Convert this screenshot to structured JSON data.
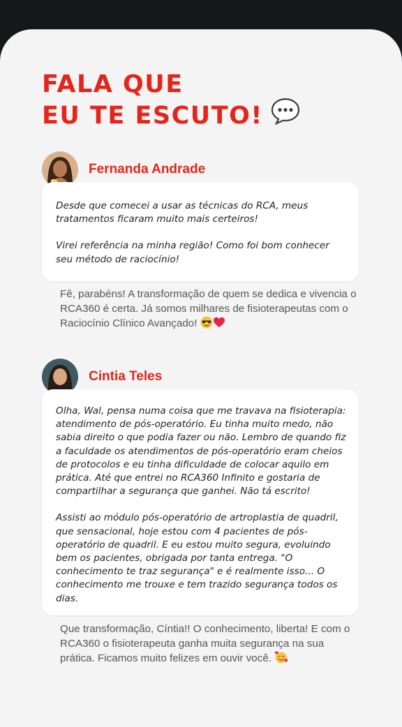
{
  "headline": {
    "line1": "FALA QUE",
    "line2": "EU TE ESCUTO!"
  },
  "icons": {
    "headline": "speech-bubble-icon",
    "reply1": [
      "sunglasses-emoji-icon",
      "heart-icon"
    ],
    "reply2": [
      "hearts-face-emoji-icon"
    ]
  },
  "colors": {
    "accent": "#e3261b",
    "background": "#16171a",
    "card": "#f4f4f4",
    "bubble": "#ffffff"
  },
  "testimonials": [
    {
      "name": "Fernanda Andrade",
      "message": [
        "Desde que comecei a usar as técnicas do RCA, meus tratamentos ficaram muito mais certeiros!",
        "Virei referência na minha região! Como foi bom conhecer seu método de raciocínio!"
      ],
      "reply": "Fê, parabéns! A transformação de quem se dedica e vivencia o RCA360 é certa. Já somos milhares de fisioterapeutas com o Raciocínio Clínico Avançado!"
    },
    {
      "name": "Cintia Teles",
      "message": [
        "Olha, Wal, pensa numa coisa que me travava na fisioterapia: atendimento de pós-operatório. Eu tinha muito medo, não sabia direito o que podia fazer ou não. Lembro de quando fiz a faculdade os atendimentos de pós-operatório eram cheios de protocolos e eu tinha dificuldade de colocar aquilo em prática. Até que entrei no RCA360 Infinito e gostaria de compartilhar a segurança que ganhei. Não tá escrito!",
        "Assisti ao módulo pós-operatório de artroplastia de quadril, que sensacional, hoje estou com 4 pacientes de pós-operatório de quadril. E eu estou muito segura, evoluindo bem os pacientes, obrigada por tanta entrega. \"O conhecimento te traz segurança\" e é realmente isso... O conhecimento me trouxe e tem trazido segurança todos os dias."
      ],
      "reply": "Que transformação, Cíntia!! O conhecimento, liberta! E com o RCA360 o fisioterapeuta ganha muita segurança na sua prática. Ficamos muito felizes em ouvir você."
    }
  ]
}
